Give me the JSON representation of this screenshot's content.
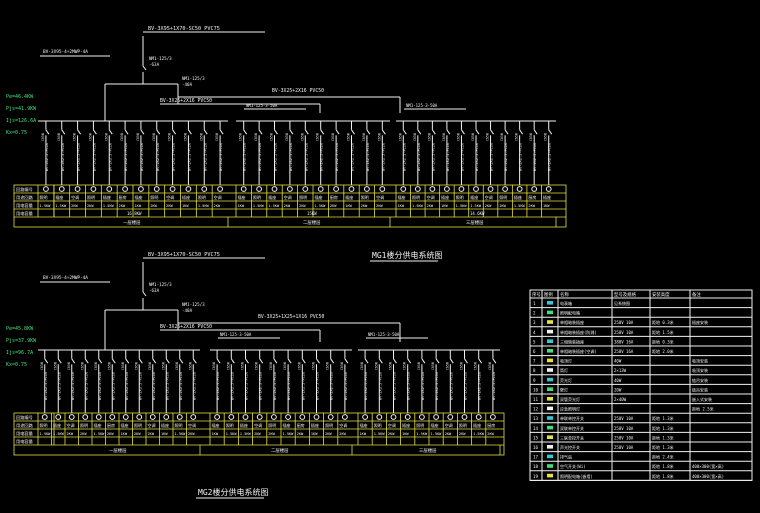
{
  "colors": {
    "background": "#000000",
    "wire": "#f2f2f2",
    "accent_yellow": "#e8e23c",
    "accent_cyan": "#33c9d6",
    "accent_green": "#3ee07a"
  },
  "diagram1": {
    "title": "MG1楼分供电系统图",
    "main_cable": "BV-3X95+1X70-SC50 PVC75",
    "left_breaker": "BV-3X95-4+2MWP-4A",
    "sub_cable_1": "BV-3X25+2X16 PVC50",
    "sub_cable_2": "BV-3X25+2X16 PVC50",
    "main_switch": "NM1-125/3",
    "main_switch_rating": "-63A",
    "sub_switch": "NM1-125/3",
    "sub_switch_rating": "-40A",
    "params": [
      "Pe=46.4KW",
      "Pjs=41.9KW",
      "Ijs=126.6A",
      "Kx=0.75"
    ],
    "panel_switches": [
      "NM1-125-3-50A",
      "NM1-125-3-50A"
    ],
    "row_labels": [
      "回路编号",
      "用途回路",
      "用电容量",
      "用电容量"
    ],
    "sections": [
      "一层楼层",
      "二层楼层",
      "三层楼层"
    ],
    "section_totals": [
      "16.8KW",
      "15KW",
      "14.6KW"
    ]
  },
  "diagram2": {
    "title": "MG2楼分供电系统图",
    "main_cable": "BV-3X95+1X70-SC50 PVC75",
    "left_breaker": "BV-3X95-4+2MWP-4A",
    "sub_cable_1": "BV-3X25+2X16 PVC50",
    "sub_cable_2": "BV-3X25+1X25+1X16 PVC50",
    "main_switch": "NM1-125/3",
    "main_switch_rating": "-63A",
    "sub_switch": "NM1-125/3",
    "sub_switch_rating": "-40A",
    "params": [
      "Pe=45.8KW",
      "Pjs=37.9KW",
      "Ijs=96.7A",
      "Kx=0.75"
    ],
    "panel_switches": [
      "NM1-125-3-50A",
      "NM1-125-3-50A"
    ],
    "row_labels": [
      "回路编号",
      "用途回路",
      "用电容量",
      "用电容量"
    ],
    "sections": [
      "一层楼层",
      "二层楼层",
      "三层楼层"
    ]
  },
  "circuit_values": [
    "1.5KW",
    "1.5KW",
    "2KW",
    "2KW",
    "1.5KW",
    "2KW",
    "1KW",
    "2KW",
    "2KW",
    "1KW",
    "1.5KW",
    "2KW",
    "1KW"
  ],
  "circuit_uses": [
    "照明",
    "插座",
    "空调",
    "照明",
    "插座",
    "厨房",
    "插座",
    "照明",
    "空调",
    "插座",
    "照明",
    "空调",
    "插座"
  ],
  "legend": {
    "headers": [
      "序号",
      "图例",
      "名称",
      "型号及规格",
      "安装高度",
      "备注"
    ],
    "rows": [
      {
        "no": "1",
        "name": "电表箱",
        "spec": "见系统图",
        "height": "",
        "note": ""
      },
      {
        "no": "2",
        "name": "照明配电箱",
        "spec": "",
        "height": "",
        "note": ""
      },
      {
        "no": "3",
        "name": "单相暗装插座",
        "spec": "250V 10A",
        "height": "距地 0.3米",
        "note": "插座安装"
      },
      {
        "no": "4",
        "name": "单相暗装插座(防溅)",
        "spec": "250V 10A",
        "height": "距地 1.5米",
        "note": ""
      },
      {
        "no": "5",
        "name": "三相暗装插座",
        "spec": "380V 16A",
        "height": "距地 0.3米",
        "note": ""
      },
      {
        "no": "6",
        "name": "单相暗装插座(空调)",
        "spec": "250V 16A",
        "height": "距地 2.0米",
        "note": ""
      },
      {
        "no": "7",
        "name": "吸顶灯",
        "spec": "40W",
        "height": "",
        "note": "吸顶安装"
      },
      {
        "no": "8",
        "name": "筒灯",
        "spec": "2×13W",
        "height": "",
        "note": "吸顶安装"
      },
      {
        "no": "9",
        "name": "荧光灯",
        "spec": "40W",
        "height": "",
        "note": "链吊安装"
      },
      {
        "no": "10",
        "name": "壁灯",
        "spec": "20W",
        "height": "",
        "note": "链吊安装"
      },
      {
        "no": "11",
        "name": "双管荧光灯",
        "spec": "2×40W",
        "height": "",
        "note": "嵌入式安装"
      },
      {
        "no": "12",
        "name": "应急照明灯",
        "spec": "",
        "height": "",
        "note": "距地 2.5米"
      },
      {
        "no": "13",
        "name": "单联单控开关",
        "spec": "250V 10A",
        "height": "距地 1.3米",
        "note": ""
      },
      {
        "no": "14",
        "name": "双联单控开关",
        "spec": "250V 10A",
        "height": "距地 1.3米",
        "note": ""
      },
      {
        "no": "15",
        "name": "三联单控开关",
        "spec": "250V 10A",
        "height": "距地 1.3米",
        "note": ""
      },
      {
        "no": "16",
        "name": "声光控开关",
        "spec": "250V 10A",
        "height": "距地 1.3米",
        "note": ""
      },
      {
        "no": "17",
        "name": "排气扇",
        "spec": "",
        "height": "距地 2.4米",
        "note": ""
      },
      {
        "no": "18",
        "name": "空气开关(Wi)",
        "spec": "",
        "height": "距地 1.8米",
        "note": "400×300(宽×高)"
      },
      {
        "no": "19",
        "name": "照明配电箱(嵌墙)",
        "spec": "",
        "height": "距地 1.8米",
        "note": "400×300(宽×高)"
      }
    ]
  }
}
